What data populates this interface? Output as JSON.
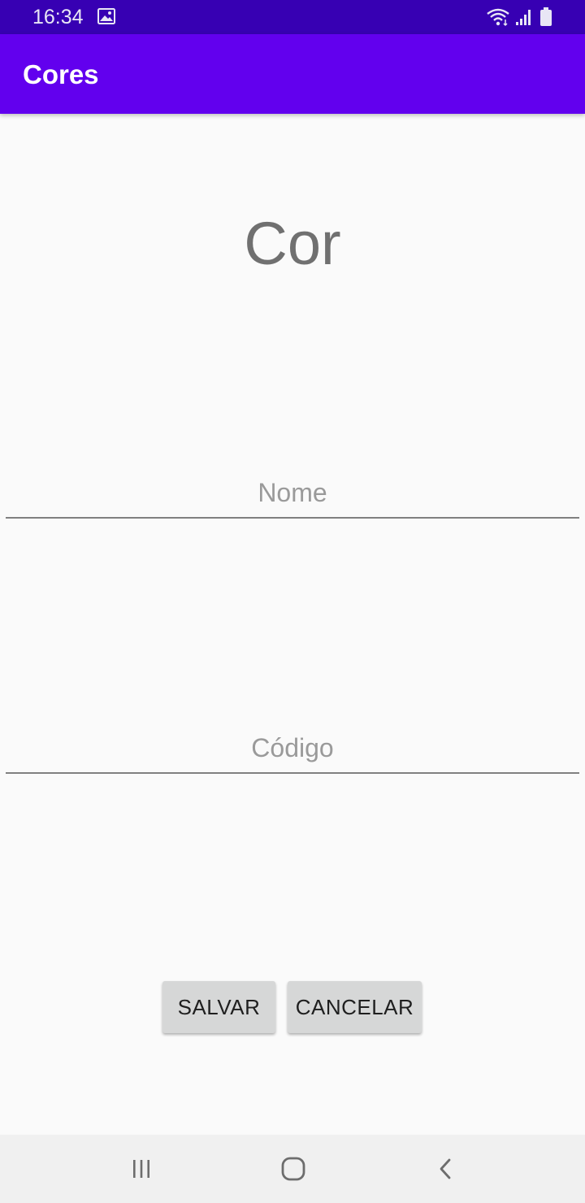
{
  "status_bar": {
    "time": "16:34",
    "icons": [
      "gallery-icon",
      "wifi-icon",
      "signal-icon",
      "battery-icon"
    ],
    "background": "#3700b3"
  },
  "app_bar": {
    "title": "Cores",
    "background": "#6200ee"
  },
  "main": {
    "heading": "Cor",
    "fields": {
      "nome": {
        "value": "",
        "placeholder": "Nome"
      },
      "codigo": {
        "value": "",
        "placeholder": "Código"
      }
    },
    "buttons": {
      "save_label": "SALVAR",
      "cancel_label": "CANCELAR"
    }
  },
  "nav_bar": {
    "icons": [
      "recents-icon",
      "home-icon",
      "back-icon"
    ]
  }
}
